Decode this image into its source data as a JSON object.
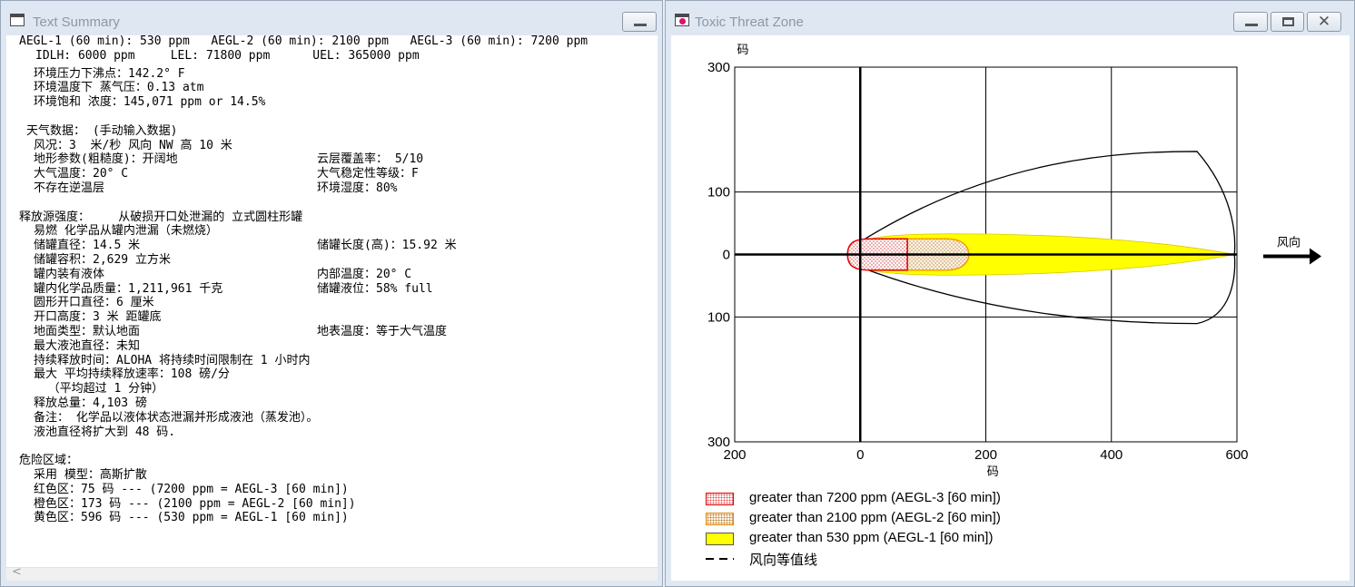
{
  "text_window": {
    "title": "Text Summary",
    "lines": [
      "AEGL-1 (60 min): 530 ppm   AEGL-2 (60 min): 2100 ppm   AEGL-3 (60 min): 7200 ppm",
      "IDLH: 6000 ppm     LEL: 71800 ppm      UEL: 365000 ppm",
      "环境压力下沸点：142.2° F",
      "环境温度下 蒸气压：0.13 atm",
      "环境饱和 浓度：145,071 ppm or 14.5%",
      "天气数据： (手动输入数据)",
      "风况：3  米/秒 风向 NW 高 10 米",
      "地形参数(粗糙度)：开阔地",
      "云层覆盖率： 5/10",
      "大气温度：20° C",
      "大气稳定性等级：F",
      "不存在逆温层",
      "环境湿度：80%",
      "释放源强度：    从破损开口处泄漏的 立式圆柱形罐",
      "易燃 化学品从罐内泄漏（未燃烧）",
      "储罐直径：14.5 米",
      "储罐长度(高)：15.92 米",
      "储罐容积：2,629 立方米",
      "罐内装有液体",
      "内部温度：20° C",
      "罐内化学品质量：1,211,961 千克",
      "储罐液位：58% full",
      "圆形开口直径：6 厘米",
      "开口高度：3 米 距罐底",
      "地面类型：默认地面",
      "地表温度：等于大气温度",
      "最大液池直径：未知",
      "持续释放时间：ALOHA 将持续时间限制在 1 小时内",
      "最大 平均持续释放速率：108 磅/分",
      "  （平均超过 1 分钟）",
      "释放总量：4,103 磅",
      "备注： 化学品以液体状态泄漏并形成液池（蒸发池）。",
      "液池直径将扩大到 48 码.",
      "危险区域：",
      "采用 模型：高斯扩散",
      "红色区：75 码 --- (7200 ppm = AEGL-3 [60 min])",
      "橙色区：173 码 --- (2100 ppm = AEGL-2 [60 min])",
      "黄色区：596 码 --- (530 ppm = AEGL-1 [60 min])"
    ],
    "scroll_arrow": "<"
  },
  "threat_window": {
    "title": "Toxic Threat Zone",
    "wind_label": "风向",
    "legend": [
      {
        "label": "greater than 7200 ppm (AEGL-3 [60 min])",
        "style": "red"
      },
      {
        "label": "greater than 2100 ppm (AEGL-2 [60 min])",
        "style": "orange"
      },
      {
        "label": "greater than 530 ppm (AEGL-1 [60 min])",
        "style": "yellow"
      },
      {
        "label": "风向等值线",
        "style": "dash"
      }
    ]
  },
  "chart_data": {
    "type": "area",
    "title": "",
    "xlabel": "码",
    "ylabel": "码",
    "xlim": [
      -200,
      600
    ],
    "ylim": [
      -300,
      300
    ],
    "x_ticks": [
      -200,
      0,
      200,
      400,
      600
    ],
    "x_tick_labels": [
      "200",
      "0",
      "200",
      "400",
      "600"
    ],
    "y_ticks": [
      300,
      100,
      0,
      -100,
      -300
    ],
    "y_tick_labels": [
      "300",
      "100",
      "0",
      "100",
      "300"
    ],
    "grid": true,
    "series": [
      {
        "name": "greater than 7200 ppm (AEGL-3 [60 min])",
        "color": "#e00000",
        "extent_downwind": 75,
        "half_width": 25
      },
      {
        "name": "greater than 2100 ppm (AEGL-2 [60 min])",
        "color": "#f0a000",
        "extent_downwind": 173,
        "half_width": 25
      },
      {
        "name": "greater than 530 ppm (AEGL-1 [60 min])",
        "color": "#ffff00",
        "extent_downwind": 596,
        "half_width": 33
      },
      {
        "name": "风向等值线",
        "color": "#000000",
        "extent_downwind": 596,
        "half_width": 165
      }
    ]
  },
  "colors": {
    "red_zone": "#e00000",
    "orange_zone": "#f0a000",
    "yellow_zone": "#ffff00",
    "title_text": "#8d97a6"
  }
}
